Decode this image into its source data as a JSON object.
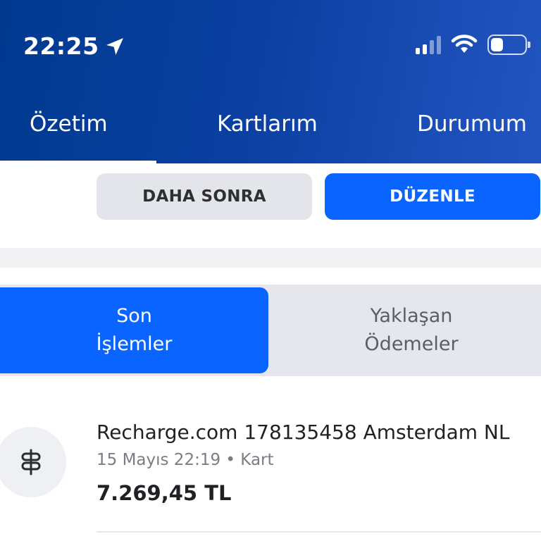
{
  "status_bar": {
    "time": "22:25",
    "location_icon": "location-arrow-icon",
    "signal_icon": "cellular-signal-icon",
    "wifi_icon": "wifi-icon",
    "battery_icon": "battery-icon",
    "battery_level": 0.25
  },
  "tabs": [
    {
      "label": "Özetim",
      "active": true
    },
    {
      "label": "Kartlarım",
      "active": false
    },
    {
      "label": "Durumum",
      "active": false
    }
  ],
  "actions": {
    "later_label": "DAHA SONRA",
    "edit_label": "DÜZENLE"
  },
  "segments": {
    "recent": {
      "line1": "Son",
      "line2": "İşlemler",
      "active": true
    },
    "upcoming": {
      "line1": "Yaklaşan",
      "line2": "Ödemeler",
      "active": false
    }
  },
  "transactions": [
    {
      "icon": "signpost-icon",
      "title": "Recharge.com 178135458 Amsterdam NL",
      "meta": "15 Mayıs 22:19 • Kart",
      "amount": "7.269,45 TL"
    }
  ],
  "colors": {
    "header_start": "#003a8f",
    "header_end": "#2355c2",
    "accent": "#0a64ff",
    "secondary_button": "#e4e5ea"
  }
}
